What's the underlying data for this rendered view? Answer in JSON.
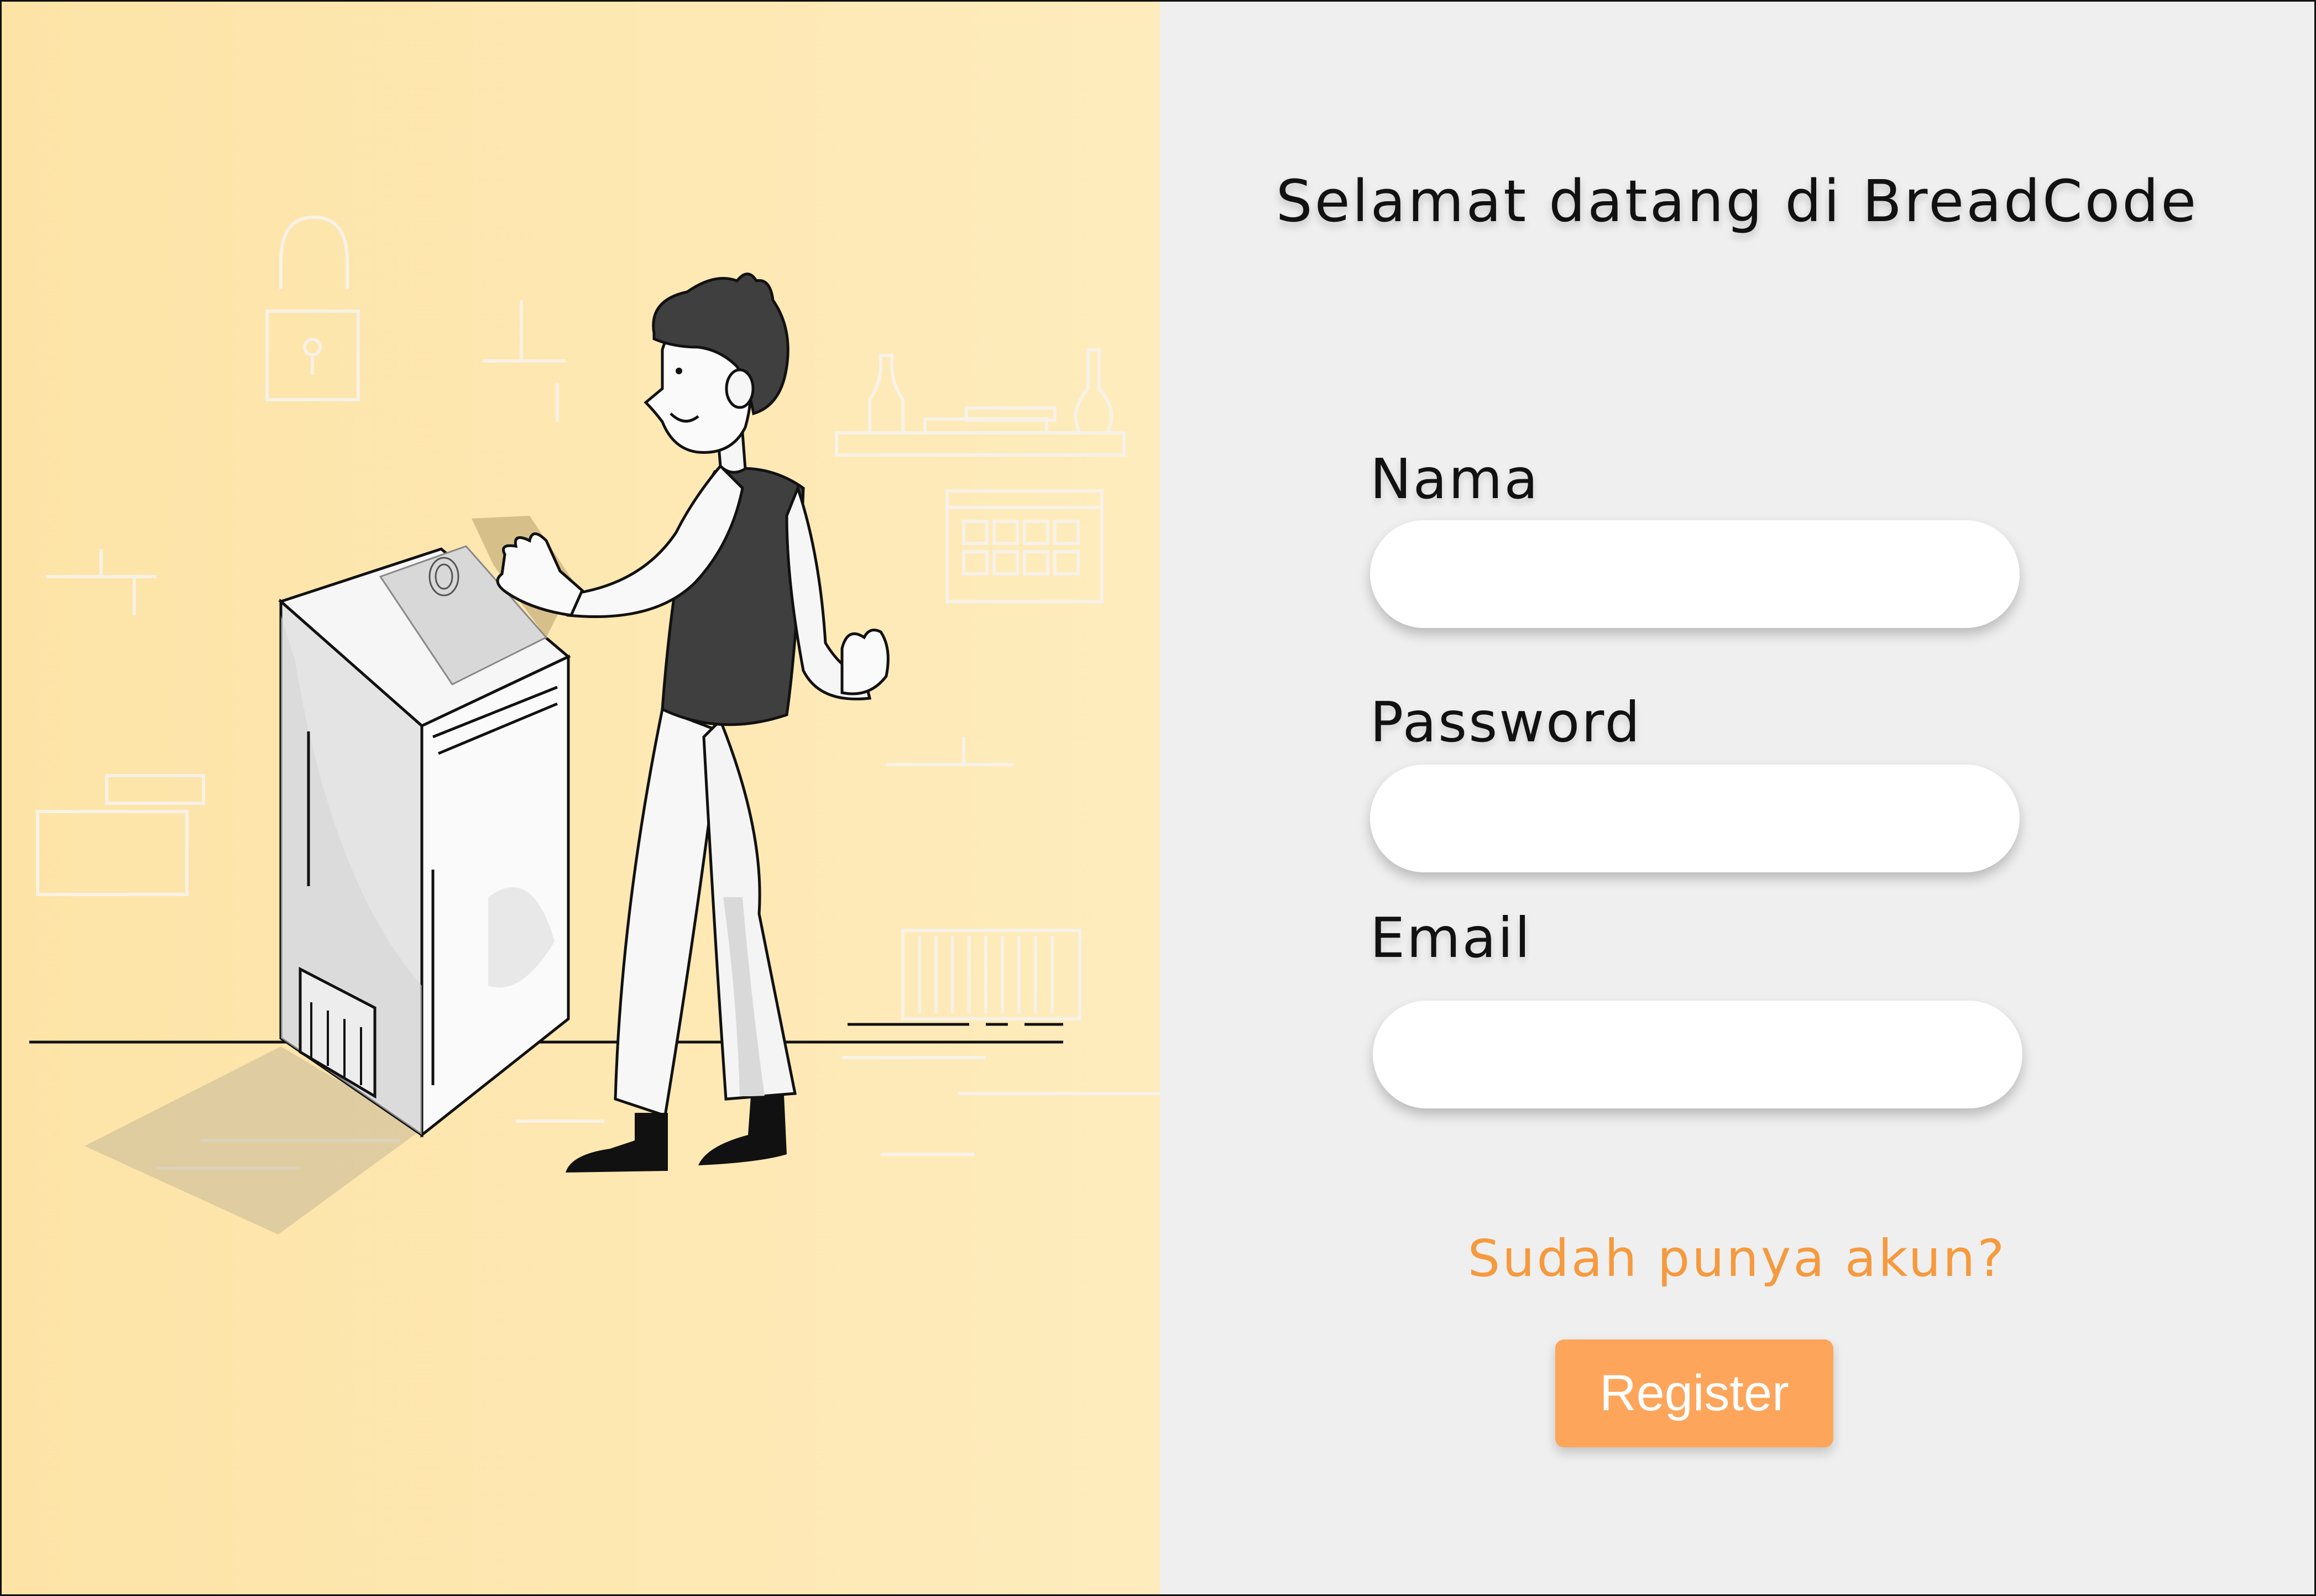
{
  "welcome_title": "Selamat datang di BreadCode",
  "form": {
    "name_label": "Nama",
    "name_value": "",
    "password_label": "Password",
    "password_value": "",
    "email_label": "Email",
    "email_value": ""
  },
  "login_link_label": "Sudah punya akun?",
  "register_label": "Register",
  "colors": {
    "accent": "#f59a3e",
    "button": "#fda55b",
    "panel_left": "#fde3a6",
    "panel_right": "#efefef"
  },
  "illustration": {
    "subject": "person-fingerprint-scanner-illustration"
  }
}
